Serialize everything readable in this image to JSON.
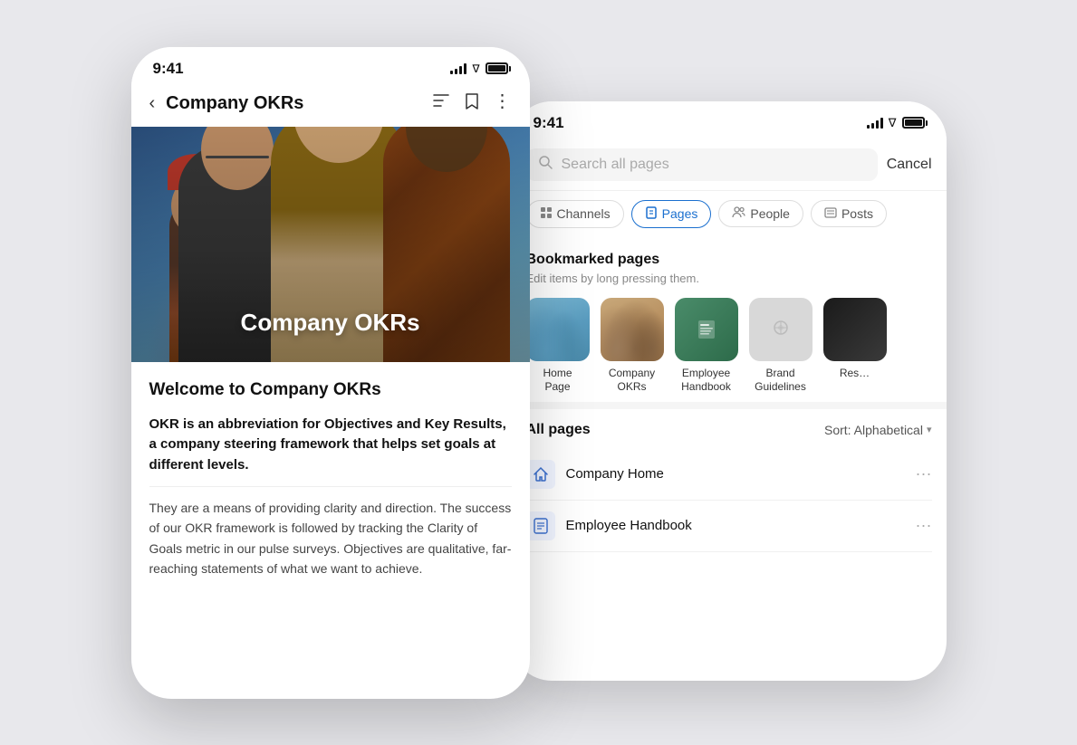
{
  "scene": {
    "background": "#e8e8ec"
  },
  "phone_front": {
    "status_bar": {
      "time": "9:41"
    },
    "nav": {
      "title": "Company OKRs",
      "back_label": "‹"
    },
    "hero": {
      "title": "Company OKRs"
    },
    "content": {
      "welcome": "Welcome to Company OKRs",
      "bold_paragraph": "OKR is an abbreviation for Objectives and Key Results, a company steering framework that helps set goals at different levels.",
      "body_paragraph": "They are a means of providing clarity and direction. The success of our OKR framework is followed by tracking the Clarity of Goals metric in our pulse surveys. Objectives are qualitative, far-reaching statements of what we want to achieve."
    }
  },
  "phone_back": {
    "status_bar": {
      "time": "9:41"
    },
    "search": {
      "placeholder": "Search all pages",
      "cancel_label": "Cancel"
    },
    "filter_tabs": [
      {
        "id": "channels",
        "label": "Channels",
        "icon": "⊞",
        "active": false
      },
      {
        "id": "pages",
        "label": "Pages",
        "icon": "📄",
        "active": true
      },
      {
        "id": "people",
        "label": "People",
        "icon": "👥",
        "active": false
      },
      {
        "id": "posts",
        "label": "Posts",
        "icon": "☰",
        "active": false
      }
    ],
    "bookmarks_section": {
      "title": "Bookmarked pages",
      "subtitle": "Edit items by long pressing them.",
      "items": [
        {
          "id": "home-page",
          "label": "Home\nPage",
          "thumb_type": "home"
        },
        {
          "id": "company-okrs",
          "label": "Company\nOKRs",
          "thumb_type": "okrs"
        },
        {
          "id": "employee-handbook",
          "label": "Employee\nHandbook",
          "thumb_type": "handbook"
        },
        {
          "id": "brand-guidelines",
          "label": "Brand\nGuidelines",
          "thumb_type": "brand"
        },
        {
          "id": "res",
          "label": "Res…",
          "thumb_type": "res"
        }
      ]
    },
    "all_pages": {
      "title": "All pages",
      "sort_label": "Sort: Alphabetical",
      "items": [
        {
          "id": "company-home",
          "label": "Company Home",
          "icon": "🏠"
        },
        {
          "id": "employee-handbook",
          "label": "Employee Handbook",
          "icon": "⊞"
        }
      ]
    }
  },
  "icons": {
    "back": "‹",
    "bookmark": "🔖",
    "list": "≡",
    "more_vert": "⋮",
    "search": "🔍",
    "more_horiz": "···"
  }
}
